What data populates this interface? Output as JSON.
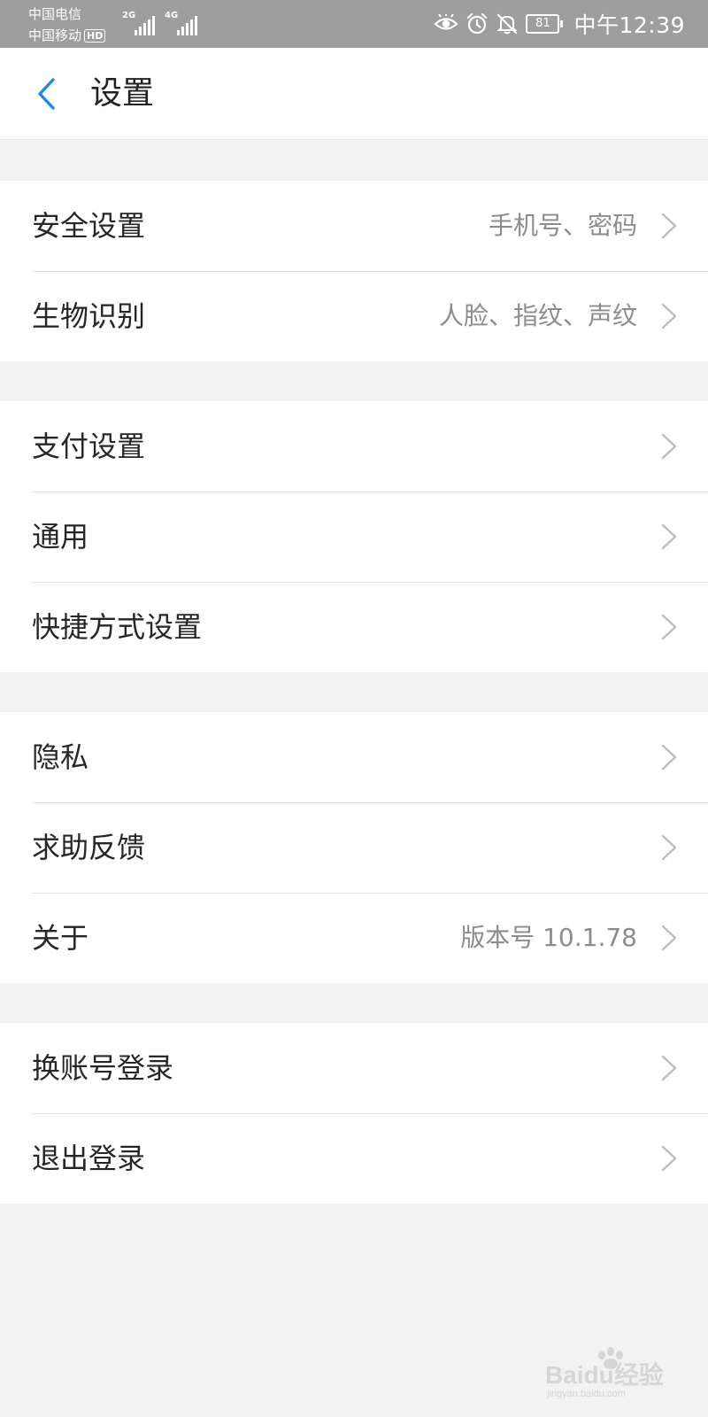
{
  "status_bar": {
    "carrier_1": "中国电信",
    "carrier_2": "中国移动",
    "hd_label": "HD",
    "signal_1_label": "2G",
    "signal_2_label": "4G",
    "battery_level": "81",
    "time": "中午12:39",
    "icons": [
      "eye-icon",
      "alarm-icon",
      "mute-bell-icon",
      "battery-icon"
    ]
  },
  "header": {
    "back_icon": "chevron-left-icon",
    "title": "设置",
    "accent_color": "#1a8ae6"
  },
  "groups": [
    {
      "items": [
        {
          "label": "安全设置",
          "value": "手机号、密码"
        },
        {
          "label": "生物识别",
          "value": "人脸、指纹、声纹"
        }
      ]
    },
    {
      "items": [
        {
          "label": "支付设置",
          "value": ""
        },
        {
          "label": "通用",
          "value": ""
        },
        {
          "label": "快捷方式设置",
          "value": ""
        }
      ]
    },
    {
      "items": [
        {
          "label": "隐私",
          "value": ""
        },
        {
          "label": "求助反馈",
          "value": ""
        },
        {
          "label": "关于",
          "value": "版本号 10.1.78"
        }
      ]
    },
    {
      "items": [
        {
          "label": "换账号登录",
          "value": ""
        },
        {
          "label": "退出登录",
          "value": ""
        }
      ]
    }
  ],
  "watermark": {
    "brand": "Baidu经验",
    "url": "jingyan.baidu.com"
  }
}
